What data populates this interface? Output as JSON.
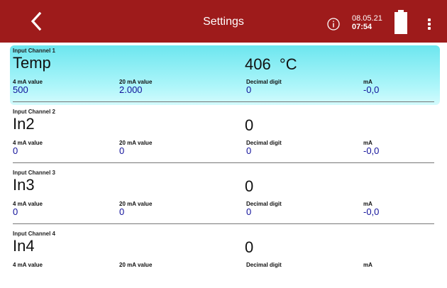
{
  "header": {
    "title": "Settings",
    "date": "08.05.21",
    "time": "07:54",
    "info_icon": "info-circle-icon",
    "back_icon": "chevron-left-icon",
    "menu_icon": "more-vert-icon",
    "battery_icon": "battery-full-icon",
    "bar_color": "#9e1b1b"
  },
  "channels": [
    {
      "label": "Input Channel 1",
      "name": "Temp",
      "value": "406  °C",
      "selected": true,
      "fields": [
        {
          "label": "4 mA value",
          "value": "500"
        },
        {
          "label": "20 mA value",
          "value": "2.000"
        },
        {
          "label": "Decimal digit",
          "value": "0"
        },
        {
          "label": "mA",
          "value": "-0,0"
        }
      ]
    },
    {
      "label": "Input Channel 2",
      "name": "In2",
      "value": "0",
      "selected": false,
      "fields": [
        {
          "label": "4 mA value",
          "value": "0"
        },
        {
          "label": "20 mA value",
          "value": "0"
        },
        {
          "label": "Decimal digit",
          "value": "0"
        },
        {
          "label": "mA",
          "value": "-0,0"
        }
      ]
    },
    {
      "label": "Input Channel 3",
      "name": "In3",
      "value": "0",
      "selected": false,
      "fields": [
        {
          "label": "4 mA value",
          "value": "0"
        },
        {
          "label": "20 mA value",
          "value": "0"
        },
        {
          "label": "Decimal digit",
          "value": "0"
        },
        {
          "label": "mA",
          "value": "-0,0"
        }
      ]
    },
    {
      "label": "Input Channel 4",
      "name": "In4",
      "value": "0",
      "selected": false,
      "fields": [
        {
          "label": "4 mA value",
          "value": ""
        },
        {
          "label": "20 mA value",
          "value": ""
        },
        {
          "label": "Decimal digit",
          "value": ""
        },
        {
          "label": "mA",
          "value": ""
        }
      ]
    }
  ]
}
